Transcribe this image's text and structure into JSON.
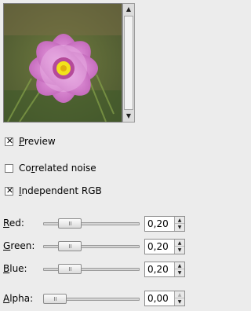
{
  "preview": {
    "scroll_up_icon": "arrow-up-icon",
    "scroll_down_icon": "arrow-down-icon"
  },
  "checkboxes": [
    {
      "label": "Preview",
      "mnemonic": "P",
      "rest": "review",
      "checked": true
    },
    {
      "label": "Correlated noise",
      "pre": "Co",
      "mnemonic": "r",
      "rest": "related noise",
      "checked": false
    },
    {
      "label": "Independent RGB",
      "mnemonic": "I",
      "rest": "ndependent RGB",
      "checked": true
    }
  ],
  "sliders": {
    "red": {
      "label": "Red:",
      "mnemonic": "R",
      "rest": "ed:",
      "value": "0,20",
      "level": 0.2
    },
    "green": {
      "label": "Green:",
      "mnemonic": "G",
      "rest": "reen:",
      "value": "0,20",
      "level": 0.2
    },
    "blue": {
      "label": "Blue:",
      "mnemonic": "B",
      "rest": "lue:",
      "value": "0,20",
      "level": 0.2
    },
    "alpha": {
      "label": "Alpha:",
      "mnemonic": "A",
      "rest": "lpha:",
      "value": "0,00",
      "level": 0.0
    }
  },
  "check_mark": "✕",
  "spin_up": "▲",
  "spin_down": "▼",
  "colors": {
    "background": "#ececec",
    "flower_petal": "#d37fc9",
    "flower_center": "#f2e21c",
    "foliage": "#5f6a3a"
  }
}
